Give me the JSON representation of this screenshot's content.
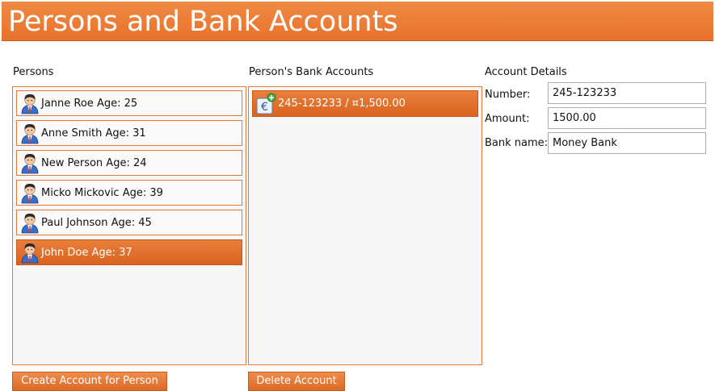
{
  "header": {
    "title": "Persons and Bank Accounts"
  },
  "persons_panel": {
    "label": "Persons",
    "items": [
      {
        "label": "Janne Roe Age: 25",
        "selected": false
      },
      {
        "label": "Anne Smith Age: 31",
        "selected": false
      },
      {
        "label": "New Person Age: 24",
        "selected": false
      },
      {
        "label": "Micko Mickovic Age: 39",
        "selected": false
      },
      {
        "label": "Paul Johnson Age: 45",
        "selected": false
      },
      {
        "label": "John Doe Age: 37",
        "selected": true
      }
    ]
  },
  "accounts_panel": {
    "label": "Person's Bank Accounts",
    "items": [
      {
        "label": "245-123233 / ¤1,500.00",
        "selected": true,
        "icon": "euro-account-icon"
      }
    ]
  },
  "details_panel": {
    "label": "Account Details",
    "fields": {
      "number": {
        "label": "Number:",
        "value": "245-123233"
      },
      "amount": {
        "label": "Amount:",
        "value": "1500.00"
      },
      "bank_name": {
        "label": "Bank name:",
        "value": "Money Bank"
      }
    }
  },
  "buttons": {
    "create_account": "Create Account for Person",
    "delete_account": "Delete Account"
  },
  "colors": {
    "accent": "#e8732e",
    "selected_bg": "#dd6b26",
    "list_bg": "#f7f7f7"
  }
}
